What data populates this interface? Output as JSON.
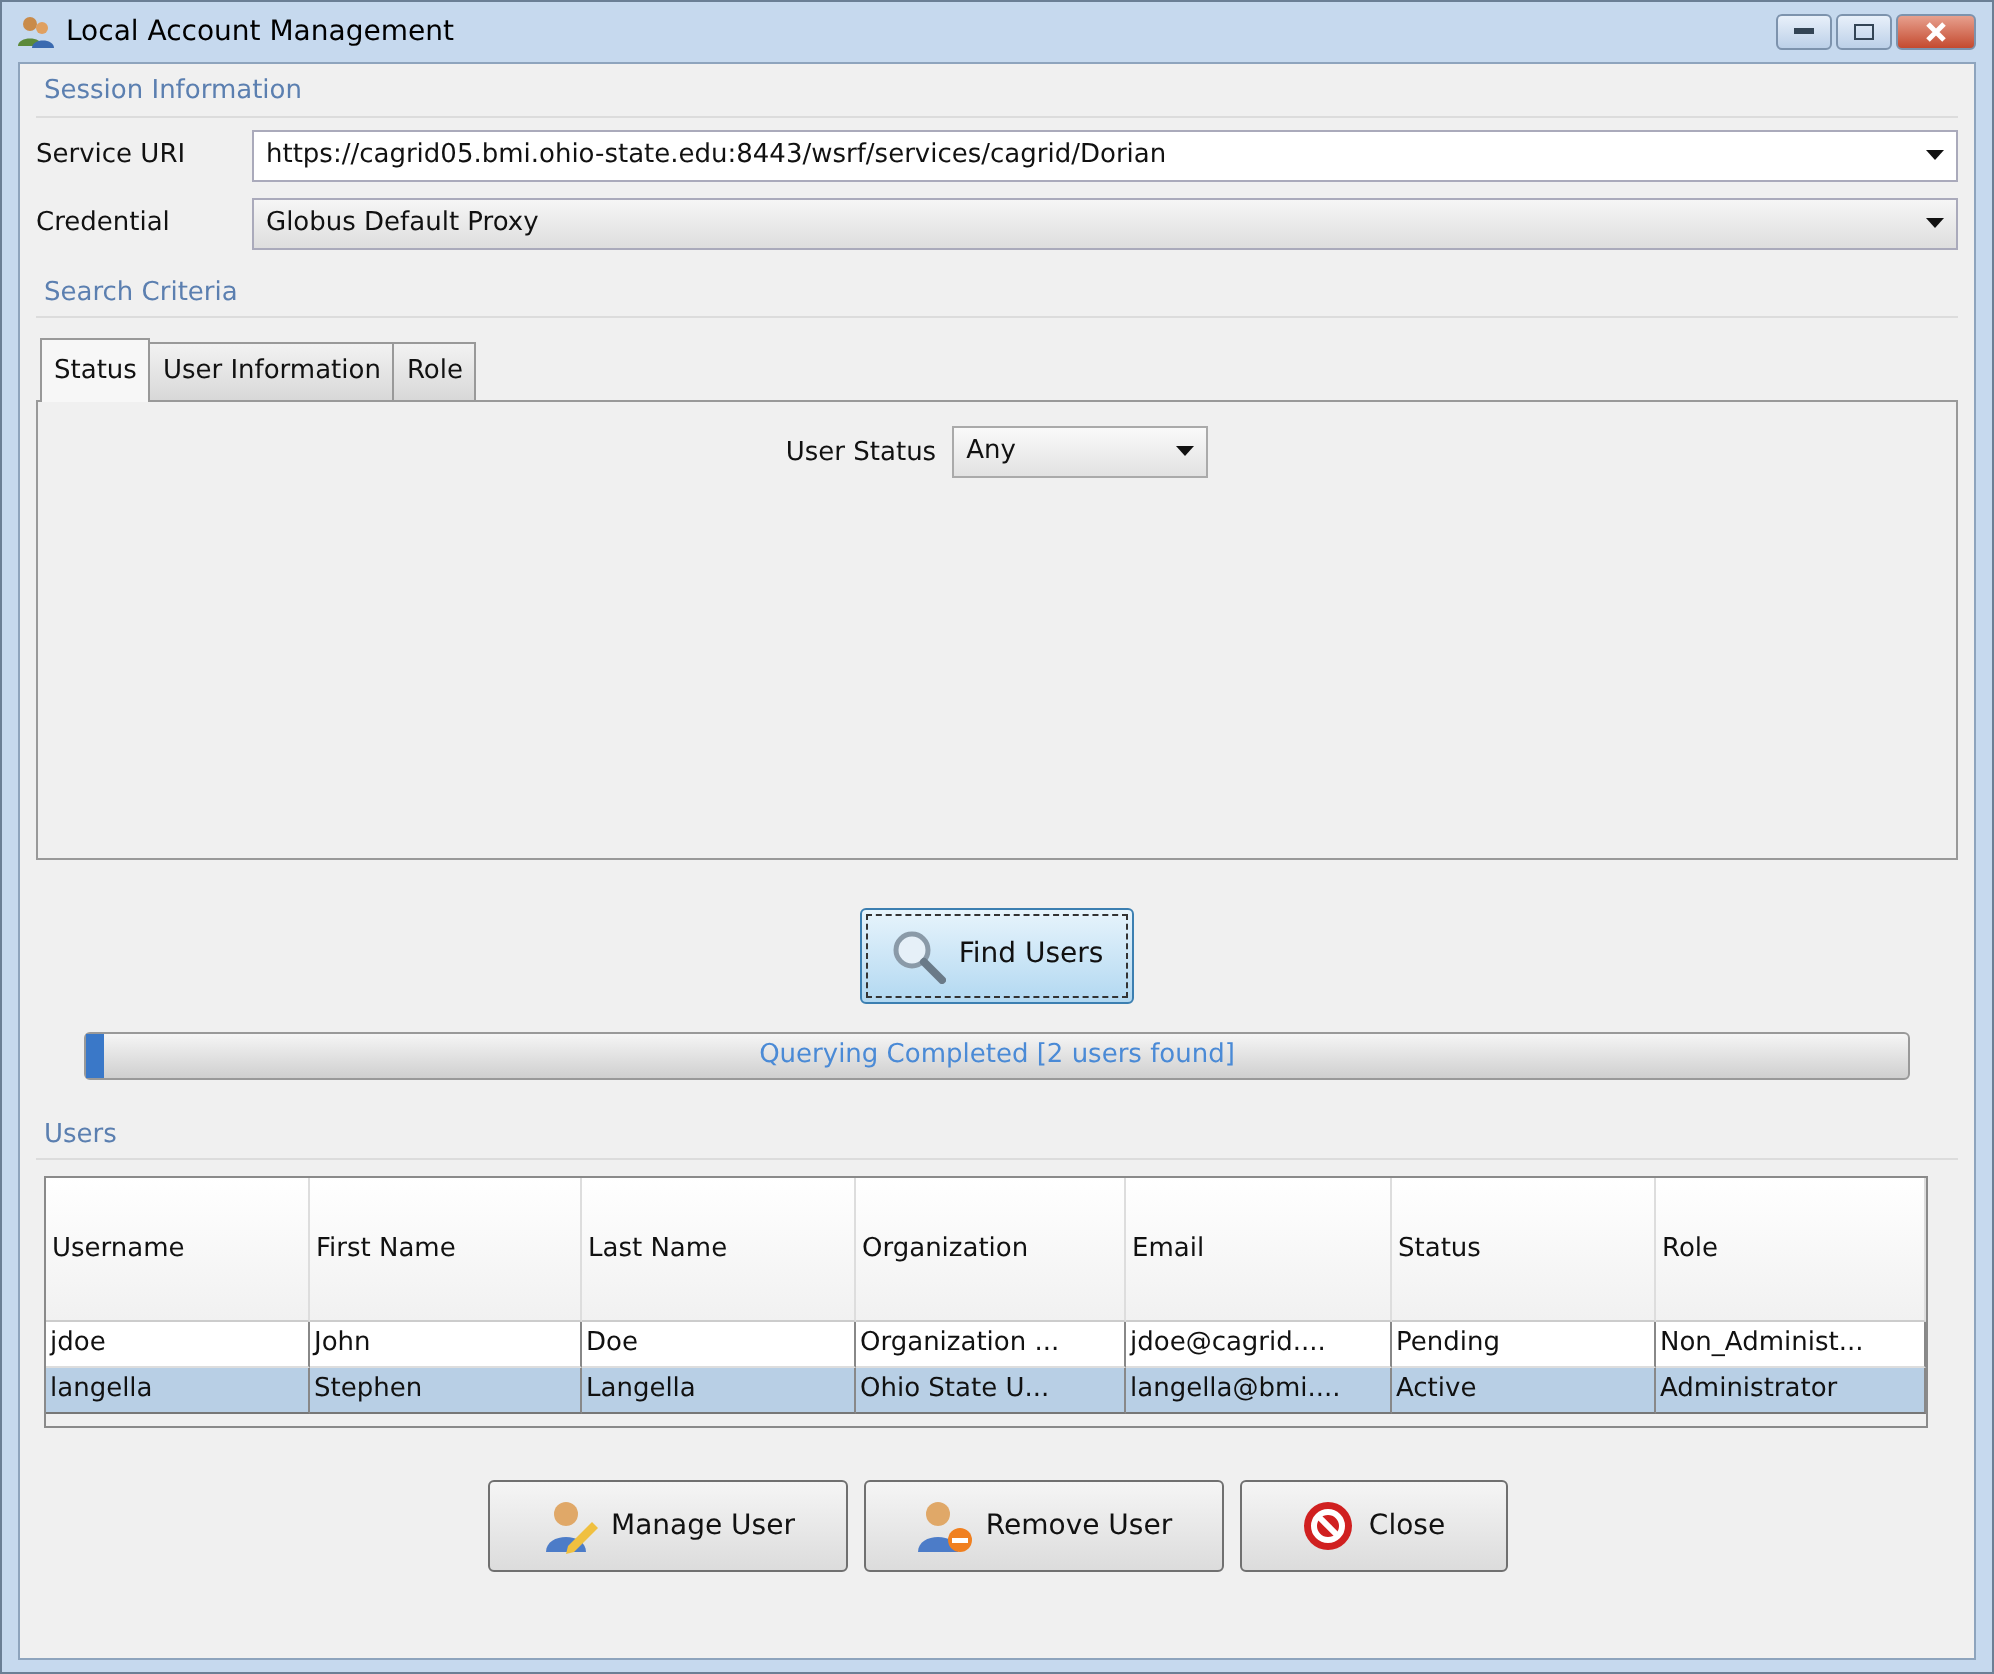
{
  "window": {
    "title": "Local Account Management"
  },
  "session": {
    "title": "Session Information",
    "fields": [
      {
        "label": "Service URI",
        "value": "https://cagrid05.bmi.ohio-state.edu:8443/wsrf/services/cagrid/Dorian",
        "kind": "editable"
      },
      {
        "label": "Credential",
        "value": "Globus Default Proxy",
        "kind": "readonly"
      }
    ]
  },
  "search": {
    "title": "Search Criteria",
    "tabs": [
      {
        "label": "Status",
        "selected": true
      },
      {
        "label": "User Information",
        "selected": false
      },
      {
        "label": "Role",
        "selected": false
      }
    ],
    "user_status": {
      "label": "User Status",
      "value": "Any"
    }
  },
  "find_button": "Find Users",
  "progress": {
    "text": "Querying Completed [2 users found]",
    "level": 0.01
  },
  "users": {
    "title": "Users",
    "columns": [
      "Username",
      "First Name",
      "Last Name",
      "Organization",
      "Email",
      "Status",
      "Role"
    ],
    "rows": [
      {
        "cells": [
          "jdoe",
          "John",
          "Doe",
          "Organization ...",
          "jdoe@cagrid....",
          "Pending",
          "Non_Administ..."
        ],
        "selected": false
      },
      {
        "cells": [
          "langella",
          "Stephen",
          "Langella",
          "Ohio State U...",
          "langella@bmi....",
          "Active",
          "Administrator"
        ],
        "selected": true
      }
    ]
  },
  "buttons": [
    {
      "label": "Manage User",
      "kind": "manage"
    },
    {
      "label": "Remove User",
      "kind": "remove"
    },
    {
      "label": "Close",
      "kind": "close"
    }
  ]
}
